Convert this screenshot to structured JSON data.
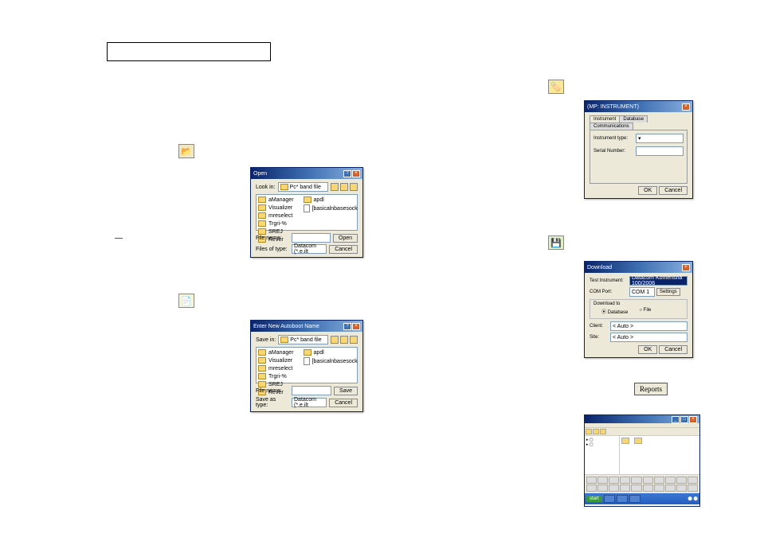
{
  "section_title": "",
  "open_dialog": {
    "title": "Open",
    "lookin_label": "Look in:",
    "lookin_value": "Pc* band file",
    "folders": [
      "aManager",
      "Visualizer",
      "mreselect",
      "Trgri-%",
      "SREJ",
      "Rever"
    ],
    "files": [
      "apdl",
      "[basicalnbasesock"
    ],
    "filename_label": "File name:",
    "filename_value": "",
    "filetype_label": "Files of type:",
    "filetype_value": "Datacom (*.e.ilt",
    "open_btn": "Open",
    "cancel_btn": "Cancel"
  },
  "save_dialog": {
    "title": "Enter New Autoboot Name",
    "savein_label": "Save in:",
    "savein_value": "Pc* band file",
    "folders": [
      "aManager",
      "Visualizer",
      "mreselect",
      "Trgri-%",
      "SREJ",
      "Rever"
    ],
    "files": [
      "apdl",
      "[basicalnbasesock"
    ],
    "filename_label": "File name:",
    "filename_value": "",
    "saveastype_label": "Save as type:",
    "saveastype_value": "Datacom (*.e.ilt",
    "save_btn": "Save",
    "cancel_btn": "Cancel"
  },
  "instrument_dialog": {
    "title": "(MP: INSTRUMENT)",
    "tabs": [
      "Instrument",
      "Database",
      "Communications"
    ],
    "label1": "Instrument type:",
    "label2": "Serial Number:",
    "ok": "OK",
    "cancel": "Cancel"
  },
  "download_dialog": {
    "title": "Download",
    "test_instr_label": "Test Instrument:",
    "test_instr_value": "Datacom Komensna 100/2006",
    "comport_label": "COM Port:",
    "comport_value": "COM 1",
    "settings_btn": "Settings",
    "downloadto_label": "Download to",
    "radio_db": "Database",
    "radio_file": "File",
    "client_label": "Client:",
    "client_value": "< Auto >",
    "site_label": "Site:",
    "site_value": "< Auto >",
    "ok": "OK",
    "cancel": "Cancel"
  },
  "reports_btn_label": "Reports",
  "dash": "—"
}
